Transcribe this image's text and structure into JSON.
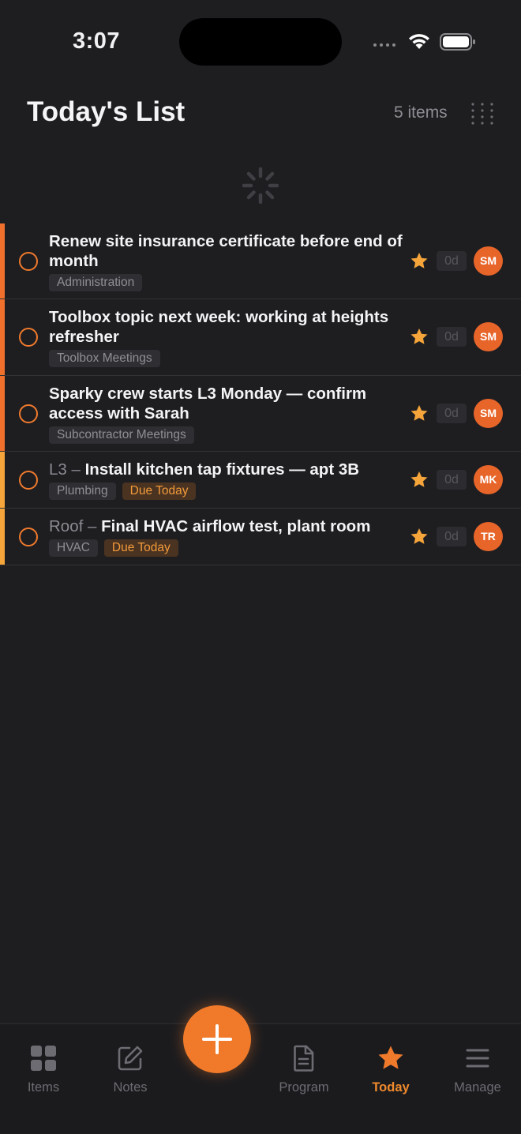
{
  "status_bar": {
    "time": "3:07"
  },
  "header": {
    "title": "Today's List",
    "count": "5 items"
  },
  "colors": {
    "accent": "#f07a2c",
    "accent_bar_red": "#f0702c",
    "accent_bar_yellow": "#f5a53a",
    "background": "#1e1e21"
  },
  "items": [
    {
      "prefix": "",
      "title": "Renew site insurance certificate before end of month",
      "tags": [
        "Administration"
      ],
      "due": "",
      "days": "0d",
      "avatar": "SM"
    },
    {
      "prefix": "",
      "title": "Toolbox topic next week: working at heights refresher",
      "tags": [
        "Toolbox Meetings"
      ],
      "due": "",
      "days": "0d",
      "avatar": "SM"
    },
    {
      "prefix": "",
      "title": "Sparky crew starts L3 Monday — confirm access with Sarah",
      "tags": [
        "Subcontractor Meetings"
      ],
      "due": "",
      "days": "0d",
      "avatar": "SM"
    },
    {
      "prefix": "L3 – ",
      "title": "Install kitchen tap fixtures — apt 3B",
      "tags": [
        "Plumbing"
      ],
      "due": "Due Today",
      "days": "0d",
      "avatar": "MK"
    },
    {
      "prefix": "Roof – ",
      "title": "Final HVAC airflow test, plant room",
      "tags": [
        "HVAC"
      ],
      "due": "Due Today",
      "days": "0d",
      "avatar": "TR"
    }
  ],
  "tabbar": {
    "items": {
      "label": "Items",
      "icon": "grid-icon"
    },
    "notes": {
      "label": "Notes",
      "icon": "edit-icon"
    },
    "program": {
      "label": "Program",
      "icon": "document-icon"
    },
    "today": {
      "label": "Today",
      "icon": "star-icon"
    },
    "manage": {
      "label": "Manage",
      "icon": "menu-icon"
    }
  }
}
